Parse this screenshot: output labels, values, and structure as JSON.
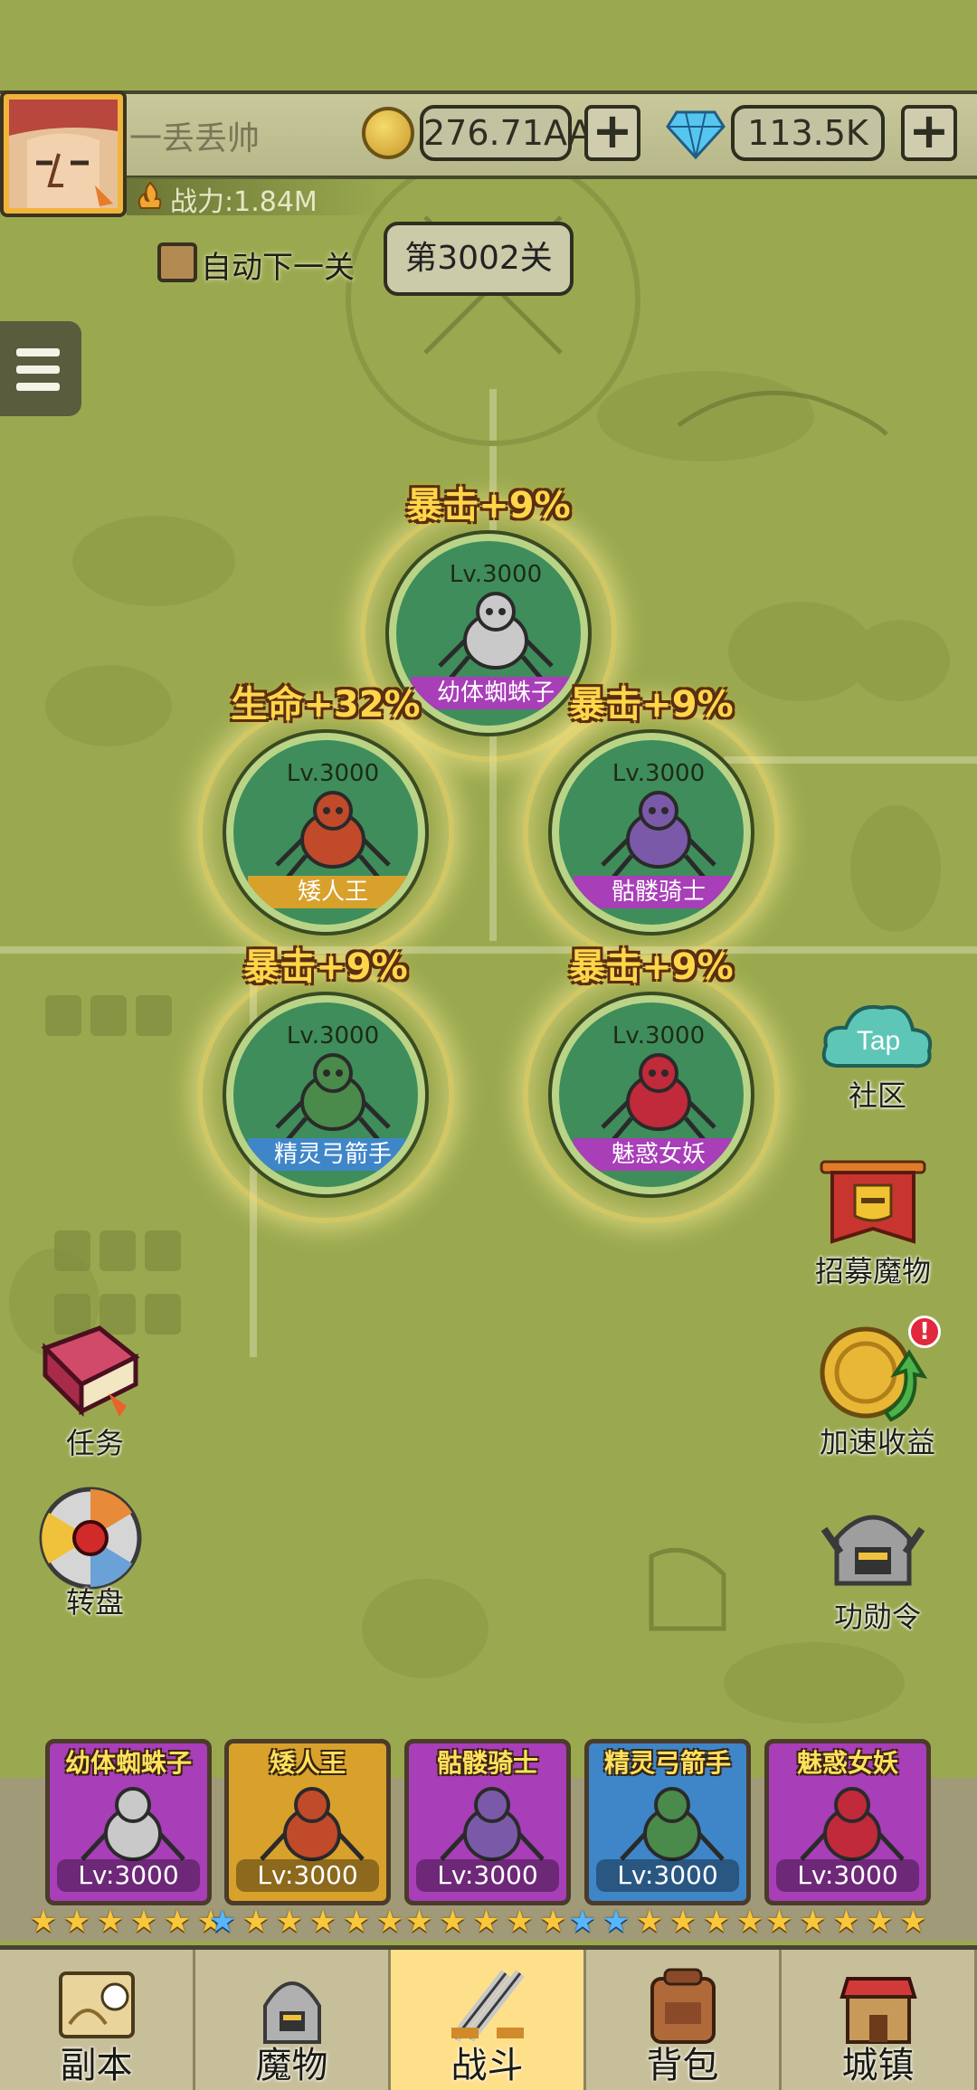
{
  "player": {
    "name": "一丢丢帅",
    "power": "战力:1.84M"
  },
  "currency": {
    "gold": "276.71AA",
    "diamond": "113.5K",
    "plus": "+"
  },
  "auto_next": {
    "label": "自动下一关",
    "checked": false
  },
  "stage": {
    "label": "第3002关"
  },
  "map_heroes": [
    {
      "name": "幼体蜘蛛子",
      "level": "Lv.3000",
      "buff": "暴击+9%",
      "bar_color": "#a83eb8"
    },
    {
      "name": "矮人王",
      "level": "Lv.3000",
      "buff": "生命+32%",
      "bar_color": "#d8a12c"
    },
    {
      "name": "骷髅骑士",
      "level": "Lv.3000",
      "buff": "暴击+9%",
      "bar_color": "#a83eb8"
    },
    {
      "name": "精灵弓箭手",
      "level": "Lv.3000",
      "buff": "暴击+9%",
      "bar_color": "#3f86c8"
    },
    {
      "name": "魅惑女妖",
      "level": "Lv.3000",
      "buff": "暴击+9%",
      "bar_color": "#a83eb8"
    }
  ],
  "side_right": [
    {
      "label": "社区",
      "icon": "tap-cloud-icon",
      "badge_text": "Tap"
    },
    {
      "label": "招募魔物",
      "icon": "recruit-banner-icon"
    },
    {
      "label": "加速收益",
      "icon": "gold-coin-boost-icon",
      "badge": "!"
    },
    {
      "label": "功勋令",
      "icon": "helmet-icon"
    }
  ],
  "side_left": [
    {
      "label": "任务",
      "icon": "quest-book-icon"
    },
    {
      "label": "转盘",
      "icon": "wheel-icon"
    }
  ],
  "lineup": [
    {
      "name": "幼体蜘蛛子",
      "level": "Lv:3000",
      "stars_gold": 6,
      "stars_blue": 0,
      "bg": "#a83eb8"
    },
    {
      "name": "矮人王",
      "level": "Lv:3000",
      "stars_gold": 5,
      "stars_blue": 1,
      "bg": "#d8a12c"
    },
    {
      "name": "骷髅骑士",
      "level": "Lv:3000",
      "stars_gold": 5,
      "stars_blue": 0,
      "bg": "#a83eb8"
    },
    {
      "name": "精灵弓箭手",
      "level": "Lv:3000",
      "stars_gold": 4,
      "stars_blue": 2,
      "bg": "#3f86c8"
    },
    {
      "name": "魅惑女妖",
      "level": "Lv:3000",
      "stars_gold": 5,
      "stars_blue": 0,
      "bg": "#a83eb8"
    }
  ],
  "nav": [
    {
      "label": "副本",
      "icon": "map-scroll-icon",
      "active": false
    },
    {
      "label": "魔物",
      "icon": "monster-helmet-icon",
      "active": false
    },
    {
      "label": "战斗",
      "icon": "crossed-swords-icon",
      "active": true
    },
    {
      "label": "背包",
      "icon": "backpack-icon",
      "active": false
    },
    {
      "label": "城镇",
      "icon": "town-shop-icon",
      "active": false
    }
  ],
  "colors": {
    "map_bg": "#9aa94f",
    "buff_text": "#ffd64a",
    "nav_active": "#ffe08a",
    "star_gold": "#f9c83a",
    "star_blue": "#56b7ff"
  }
}
